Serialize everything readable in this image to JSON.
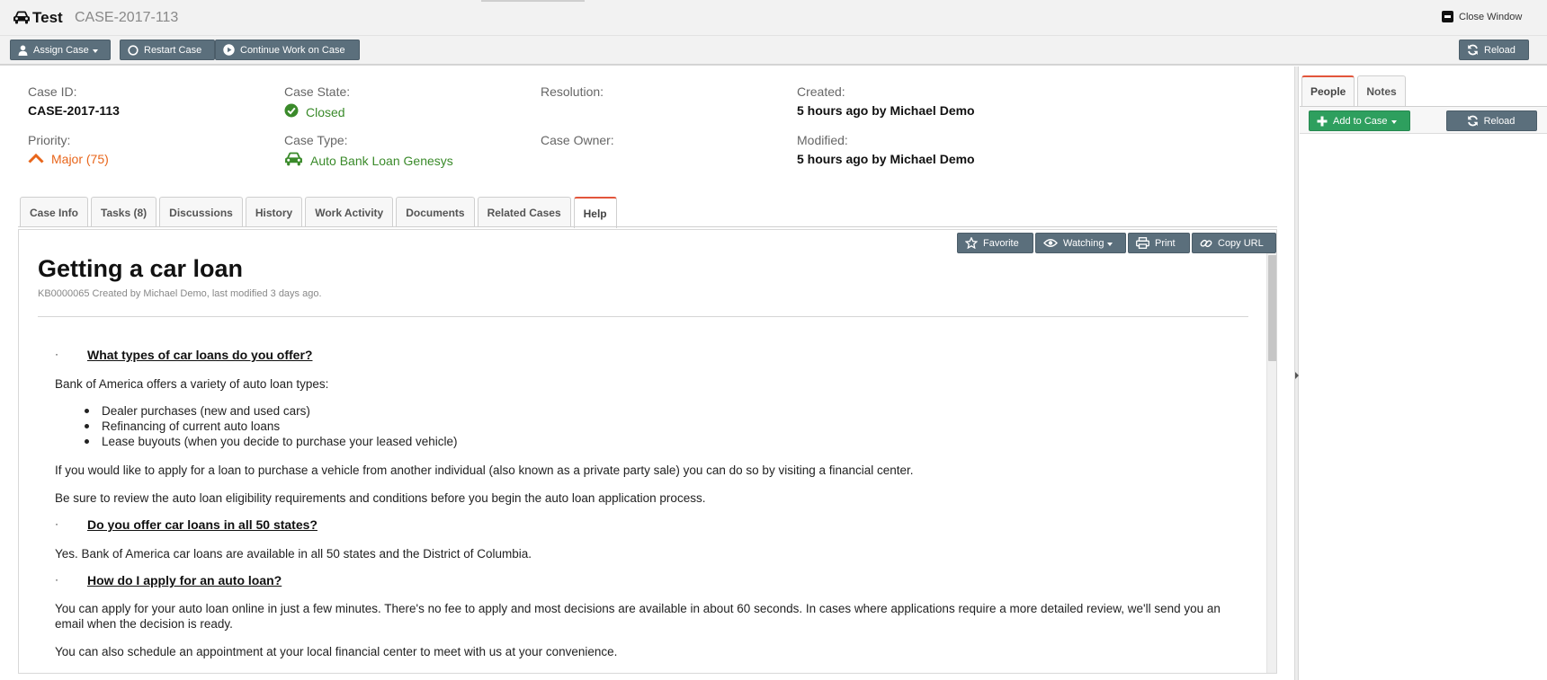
{
  "titlebar": {
    "app_name": "Test",
    "case_number": "CASE-2017-113",
    "app_icon": "car-icon",
    "close_label": "Close Window",
    "close_icon": "close-window-icon"
  },
  "toolbar": {
    "assign_label": "Assign Case",
    "restart_label": "Restart Case",
    "continue_label": "Continue Work on Case",
    "reload_label": "Reload"
  },
  "case": {
    "id_label": "Case ID:",
    "id_value": "CASE-2017-113",
    "state_label": "Case State:",
    "state_value": "Closed",
    "resolution_label": "Resolution:",
    "created_label": "Created:",
    "created_value": "5 hours ago by Michael Demo",
    "priority_label": "Priority:",
    "priority_value": "Major (75)",
    "type_label": "Case Type:",
    "type_value": "Auto Bank Loan Genesys",
    "owner_label": "Case Owner:",
    "modified_label": "Modified:",
    "modified_value": "5 hours ago by Michael Demo"
  },
  "colors": {
    "closed_green": "#3a8a2a",
    "priority_orange": "#e8651a",
    "button_slate": "#5b6f7c",
    "button_green": "#2e9f5e",
    "active_tab_accent": "#e2553b"
  },
  "tabs": [
    "Case Info",
    "Tasks (8)",
    "Discussions",
    "History",
    "Work Activity",
    "Documents",
    "Related Cases",
    "Help"
  ],
  "active_tab": "Help",
  "doc_toolbar": {
    "favorite": "Favorite",
    "watching": "Watching",
    "print": "Print",
    "copy_url": "Copy URL"
  },
  "article": {
    "title": "Getting a car loan",
    "meta": "KB0000065 Created by Michael Demo, last modified 3 days ago.",
    "bullet": "·",
    "q1": "What types of car loans do you offer?",
    "p1": "Bank of America offers a variety of auto loan types:",
    "list": [
      "Dealer purchases (new and used cars)",
      "Refinancing of current auto loans",
      "Lease buyouts (when you decide to purchase your leased vehicle)"
    ],
    "p2": "If you would like to apply for a loan to purchase a vehicle from another individual (also known as a private party sale) you can do so by visiting a financial center.",
    "p3": "Be sure to review the auto loan eligibility requirements and conditions before you begin the auto loan application process.",
    "q2": "Do you offer car loans in all 50 states?",
    "p4": "Yes. Bank of America car loans are available in all 50 states and the District of Columbia.",
    "q3": "How do I apply for an auto loan?",
    "p5": "You can apply for your auto loan online in just a few minutes. There's no fee to apply and most decisions are available in about 60 seconds. In cases where applications require a more detailed review, we'll send you an email when the decision is ready.",
    "p6": "You can also schedule an appointment at your local financial center to meet with us at your convenience."
  },
  "right_panel": {
    "tabs": [
      "People",
      "Notes"
    ],
    "active_tab": "People",
    "add_label": "Add to Case",
    "reload_label": "Reload"
  }
}
